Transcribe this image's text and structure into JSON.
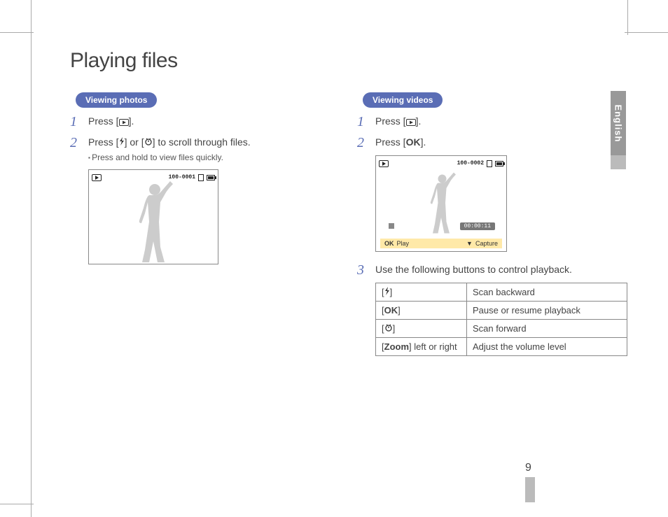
{
  "title": "Playing files",
  "language_tab": "English",
  "page_number": "9",
  "photos": {
    "section_label": "Viewing photos",
    "step1_prefix": "Press [",
    "step1_suffix": "].",
    "step2_prefix": "Press [",
    "step2_mid": "] or [",
    "step2_suffix": "] to scroll through files.",
    "step2_sub": "Press and hold to view files quickly.",
    "lcd_counter": "100-0001"
  },
  "videos": {
    "section_label": "Viewing videos",
    "step1_prefix": "Press [",
    "step1_suffix": "].",
    "step2_prefix": "Press [",
    "step2_ok": "OK",
    "step2_suffix": "].",
    "lcd_counter": "100-0002",
    "lcd_time": "00:00:11",
    "lcd_play_label": "Play",
    "lcd_capture_label": "Capture",
    "step3": "Use the following buttons to control playback.",
    "table": {
      "r1_key_open": "[",
      "r1_key_close": "]",
      "r1_val": "Scan backward",
      "r2_key_open": "[",
      "r2_ok": "OK",
      "r2_key_close": "]",
      "r2_val": "Pause or resume playback",
      "r3_key_open": "[",
      "r3_key_close": "]",
      "r3_val": "Scan forward",
      "r4_key_open": "[",
      "r4_zoom": "Zoom",
      "r4_rest": "] left or right",
      "r4_val": "Adjust the volume level"
    }
  }
}
